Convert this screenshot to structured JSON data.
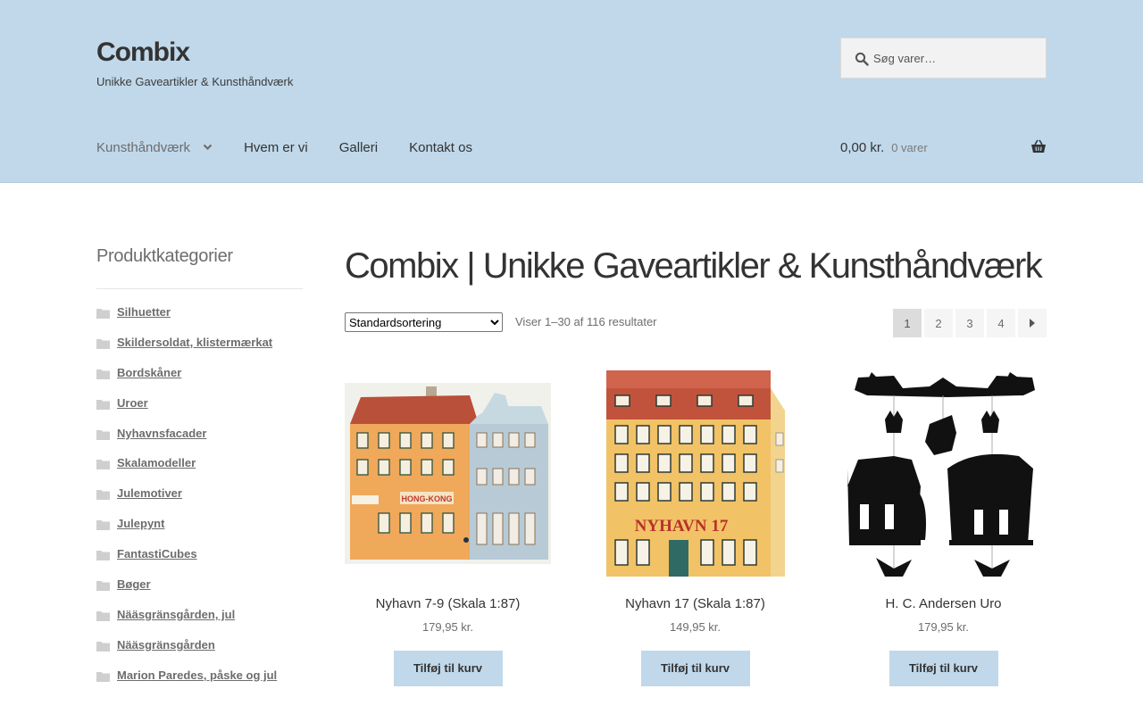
{
  "header": {
    "site_title": "Combix",
    "site_description": "Unikke Gaveartikler & Kunsthåndværk",
    "search_placeholder": "Søg varer…",
    "search_icon": "search-icon",
    "nav": [
      {
        "label": "Kunsthåndværk",
        "has_dropdown": true
      },
      {
        "label": "Hvem er vi"
      },
      {
        "label": "Galleri"
      },
      {
        "label": "Kontakt os"
      }
    ],
    "cart": {
      "amount": "0,00 kr.",
      "count": "0 varer",
      "icon": "basket-icon"
    },
    "background_color": "#c0d8ea"
  },
  "sidebar": {
    "title": "Produktkategorier",
    "categories": [
      "Silhuetter",
      "Skildersoldat, klistermærkat",
      "Bordskåner",
      "Uroer",
      "Nyhavnsfacader",
      "Skalamodeller",
      "Julemotiver",
      "Julepynt",
      "FantastiCubes",
      "Bøger",
      "Nääsgränsgården, jul",
      "Nääsgränsgården",
      "Marion Paredes, påske og jul"
    ]
  },
  "main": {
    "title": "Combix | Unikke Gaveartikler & Kunsthåndværk",
    "sort_selected": "Standardsortering",
    "result_count": "Viser 1–30 af 116 resultater",
    "pages": [
      "1",
      "2",
      "3",
      "4"
    ],
    "current_page": "1"
  },
  "products": [
    {
      "name": "Nyhavn 7-9 (Skala 1:87)",
      "price": "179,95 kr.",
      "button": "Tilføj til kurv",
      "sign": "HONG-KONG"
    },
    {
      "name": "Nyhavn 17 (Skala 1:87)",
      "price": "149,95 kr.",
      "button": "Tilføj til kurv",
      "sign": "NYHAVN 17"
    },
    {
      "name": "H. C. Andersen Uro",
      "price": "179,95 kr.",
      "button": "Tilføj til kurv"
    }
  ]
}
